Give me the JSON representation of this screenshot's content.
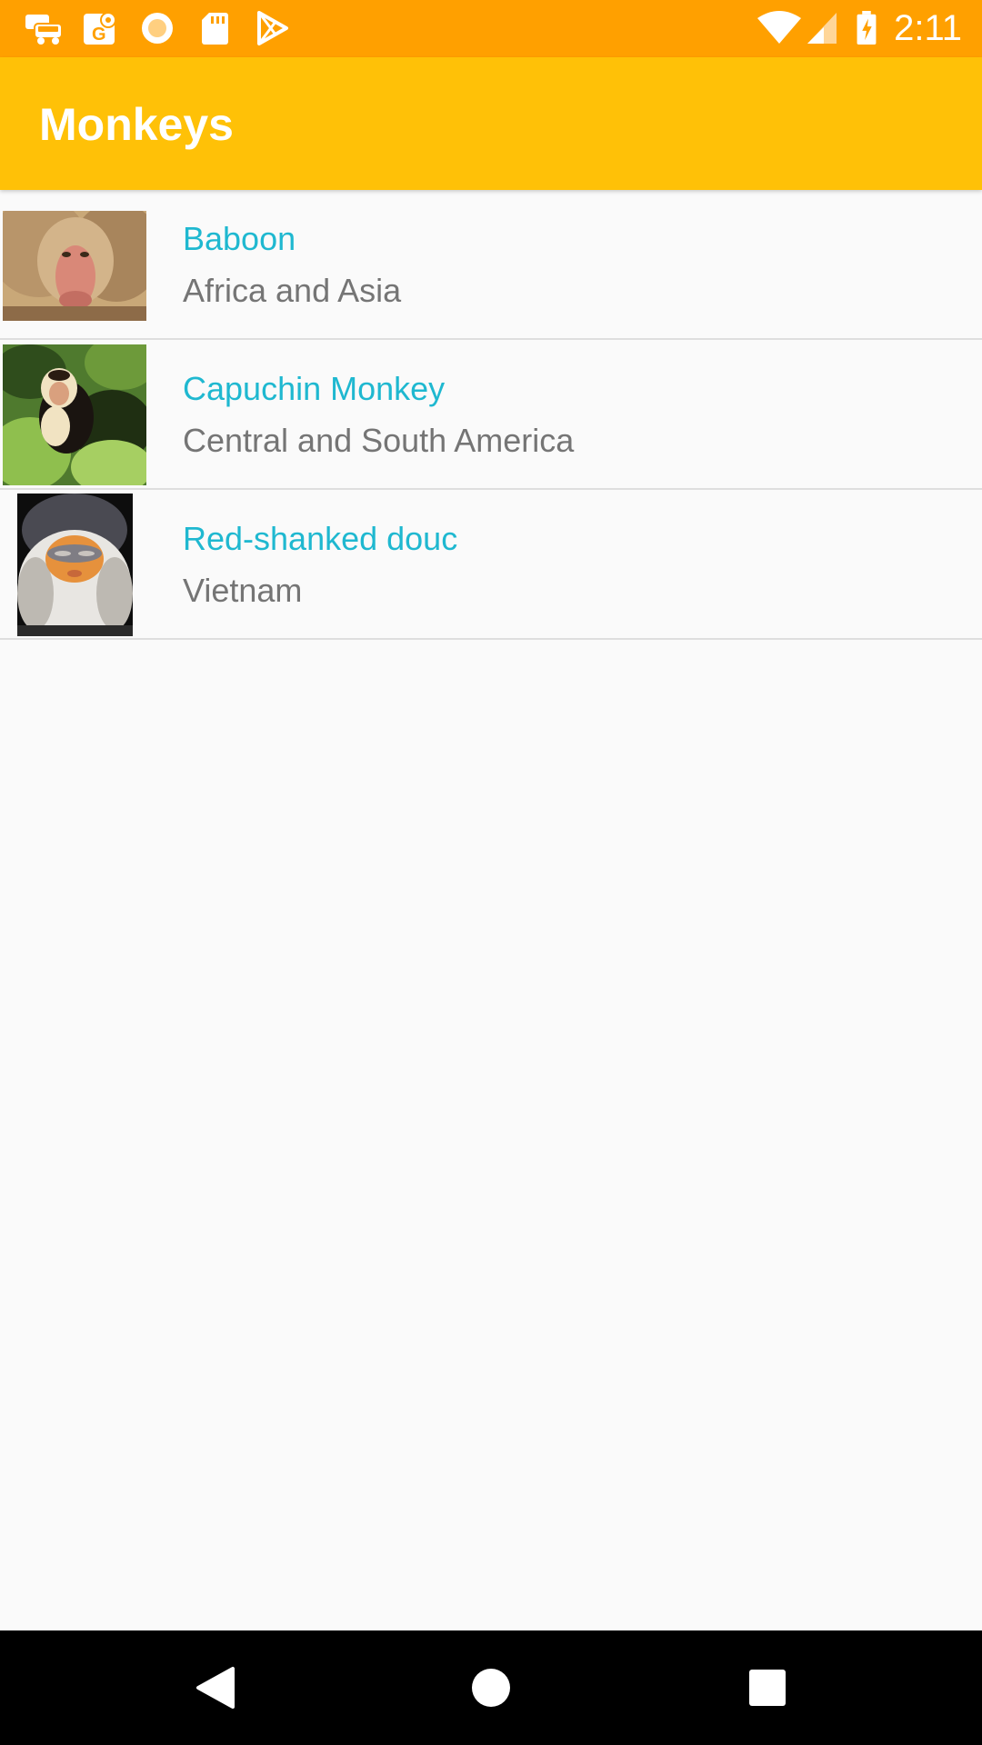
{
  "status_bar": {
    "time": "2:11",
    "icons": [
      "car-notification-icon",
      "maps-notification-icon",
      "circle-notification-icon",
      "sd-card-icon",
      "play-store-icon",
      "wifi-icon",
      "signal-icon",
      "battery-charging-icon"
    ],
    "background": "#ffa000"
  },
  "app_bar": {
    "title": "Monkeys",
    "background": "#ffc107"
  },
  "monkeys": [
    {
      "name": "Baboon",
      "location": "Africa and Asia",
      "image": "baboon-photo"
    },
    {
      "name": "Capuchin Monkey",
      "location": "Central and South America",
      "image": "capuchin-photo"
    },
    {
      "name": "Red-shanked douc",
      "location": "Vietnam",
      "image": "douc-photo"
    }
  ],
  "colors": {
    "name_text": "#1fb8d0",
    "location_text": "#757575",
    "divider": "#dedede"
  },
  "nav_bar": {
    "buttons": [
      "back-button",
      "home-button",
      "recents-button"
    ]
  }
}
